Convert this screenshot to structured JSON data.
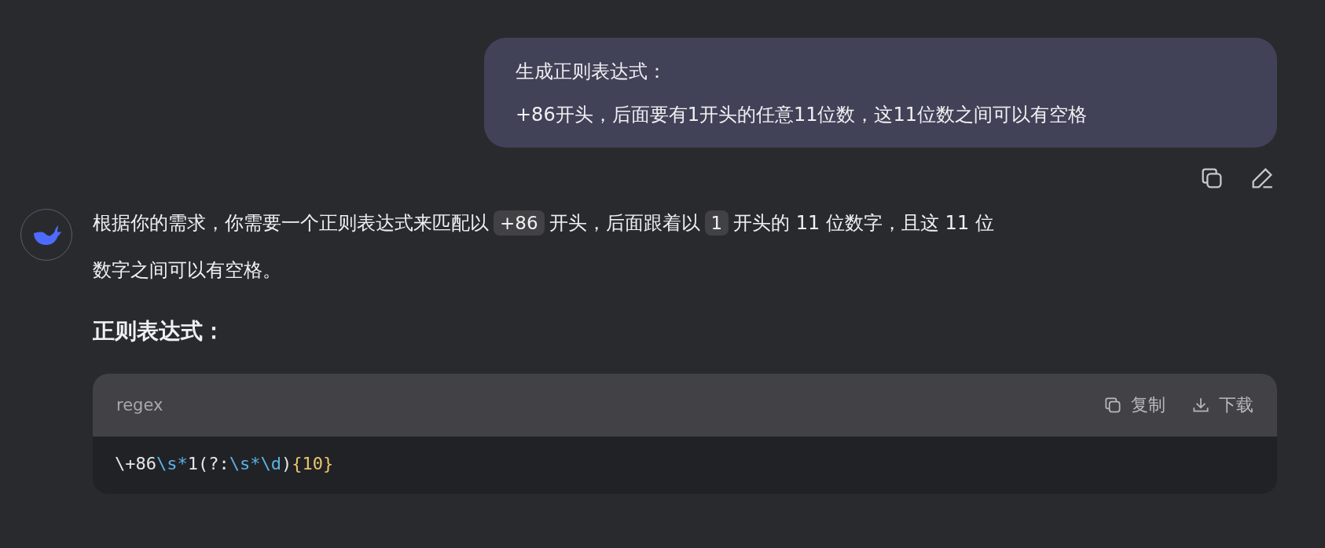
{
  "user_message": {
    "lines": [
      "生成正则表达式：",
      "+86开头，后面要有1开头的任意11位数，这11位数之间可以有空格"
    ]
  },
  "message_actions": [
    {
      "kind": "copy"
    },
    {
      "kind": "edit"
    }
  ],
  "answer": {
    "lines": [
      [
        {
          "kind": "text",
          "text": "根据你的需求，你需要一个正则表达式来匹配以"
        },
        {
          "kind": "code",
          "text": "+86"
        },
        {
          "kind": "text",
          "text": "开头，后面跟着以"
        },
        {
          "kind": "code",
          "text": "1"
        },
        {
          "kind": "text",
          "text": "开头的 11 位数字，且这 11 位"
        }
      ],
      [
        {
          "kind": "text",
          "text": "数字之间可以有空格。"
        }
      ]
    ],
    "heading": "正则表达式：",
    "code_block": {
      "language": "regex",
      "actions": [
        {
          "kind": "copy",
          "label": "复制"
        },
        {
          "kind": "download",
          "label": "下载"
        }
      ],
      "tokens": [
        {
          "kind": "plain",
          "text": "\\+86"
        },
        {
          "kind": "escape",
          "text": "\\s*"
        },
        {
          "kind": "plain",
          "text": "1(?:"
        },
        {
          "kind": "escape",
          "text": "\\s*\\d"
        },
        {
          "kind": "plain",
          "text": ")"
        },
        {
          "kind": "quantifier",
          "text": "{10}"
        }
      ]
    }
  }
}
